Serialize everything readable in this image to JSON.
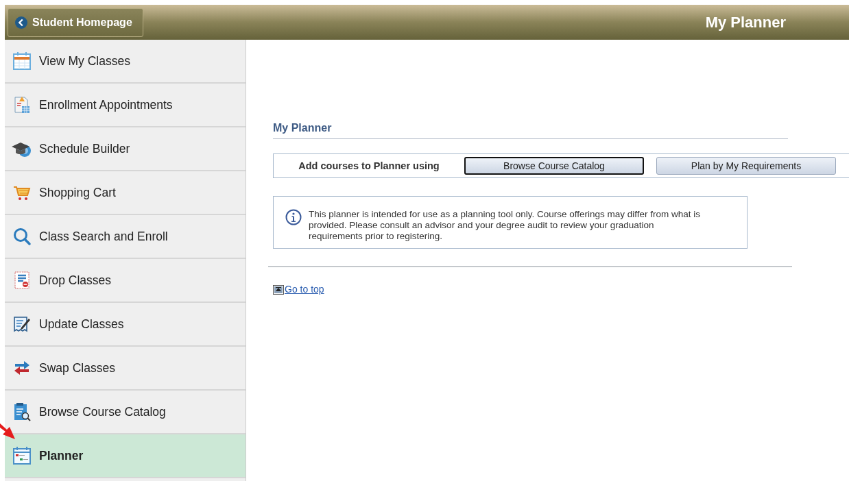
{
  "header": {
    "back_button": "Student Homepage",
    "title": "My Planner"
  },
  "sidebar": {
    "items": [
      {
        "label": "View My Classes",
        "kind": "calendar",
        "selected": false
      },
      {
        "label": "Enrollment Appointments",
        "kind": "appointment",
        "selected": false
      },
      {
        "label": "Schedule Builder",
        "kind": "cap",
        "selected": false
      },
      {
        "label": "Shopping Cart",
        "kind": "cart",
        "selected": false
      },
      {
        "label": "Class Search and Enroll",
        "kind": "search",
        "selected": false
      },
      {
        "label": "Drop Classes",
        "kind": "drop",
        "selected": false
      },
      {
        "label": "Update Classes",
        "kind": "edit",
        "selected": false
      },
      {
        "label": "Swap Classes",
        "kind": "swap",
        "selected": false
      },
      {
        "label": "Browse Course Catalog",
        "kind": "catalog",
        "selected": false
      },
      {
        "label": "Planner",
        "kind": "planner",
        "selected": true
      }
    ]
  },
  "pointer_arrow": true,
  "section": {
    "title": "My Planner",
    "add_label": "Add courses to Planner using",
    "buttons": [
      {
        "label": "Browse Course Catalog",
        "focused": true
      },
      {
        "label": "Plan by My Requirements",
        "focused": false
      }
    ],
    "info": "This planner is intended for use as a planning tool only.  Course offerings may differ from what is provided.  Please consult an advisor and your degree audit to review your graduation requirements prior to registering.",
    "go_to_top": "Go to top"
  }
}
